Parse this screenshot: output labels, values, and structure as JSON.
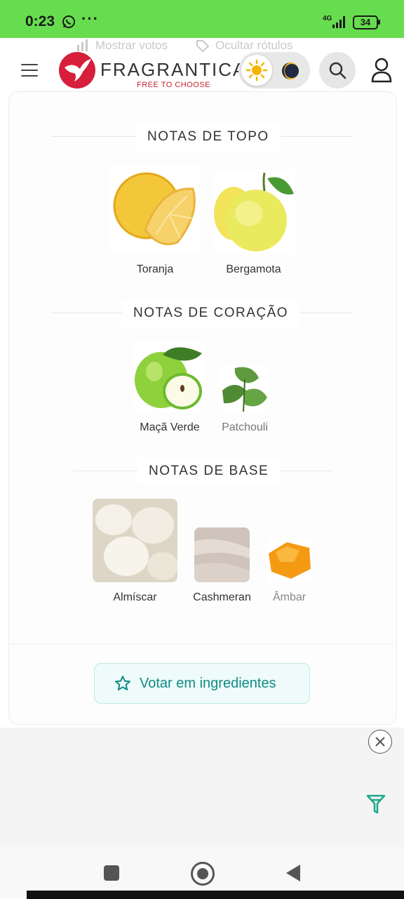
{
  "status_bar": {
    "time": "0:23",
    "more_dots": "···",
    "network": "4G",
    "battery": "34"
  },
  "header": {
    "ghost_show_votes": "Mostrar votos",
    "ghost_hide_labels": "Ocultar rótulos",
    "brand_name": "FRAGRANTICA",
    "brand_tagline": "FREE TO CHOOSE"
  },
  "sections": {
    "top": {
      "title": "NOTAS DE TOPO",
      "notes": [
        {
          "label": "Toranja",
          "icon": "grapefruit"
        },
        {
          "label": "Bergamota",
          "icon": "bergamot"
        }
      ]
    },
    "heart": {
      "title": "NOTAS DE CORAÇÃO",
      "notes": [
        {
          "label": "Maçã Verde",
          "icon": "green-apple"
        },
        {
          "label": "Patchouli",
          "icon": "patchouli-leaf"
        }
      ]
    },
    "base": {
      "title": "NOTAS DE BASE",
      "notes": [
        {
          "label": "Almíscar",
          "icon": "musk"
        },
        {
          "label": "Cashmeran",
          "icon": "cashmere-fabric"
        },
        {
          "label": "Âmbar",
          "icon": "amber-stone"
        }
      ]
    }
  },
  "vote_button": {
    "label": "Votar em ingredientes"
  },
  "colors": {
    "status_bar": "#66dd4e",
    "brand_red": "#d71e3a",
    "accent_teal": "#118a84",
    "vote_bg": "#eefbfa"
  }
}
